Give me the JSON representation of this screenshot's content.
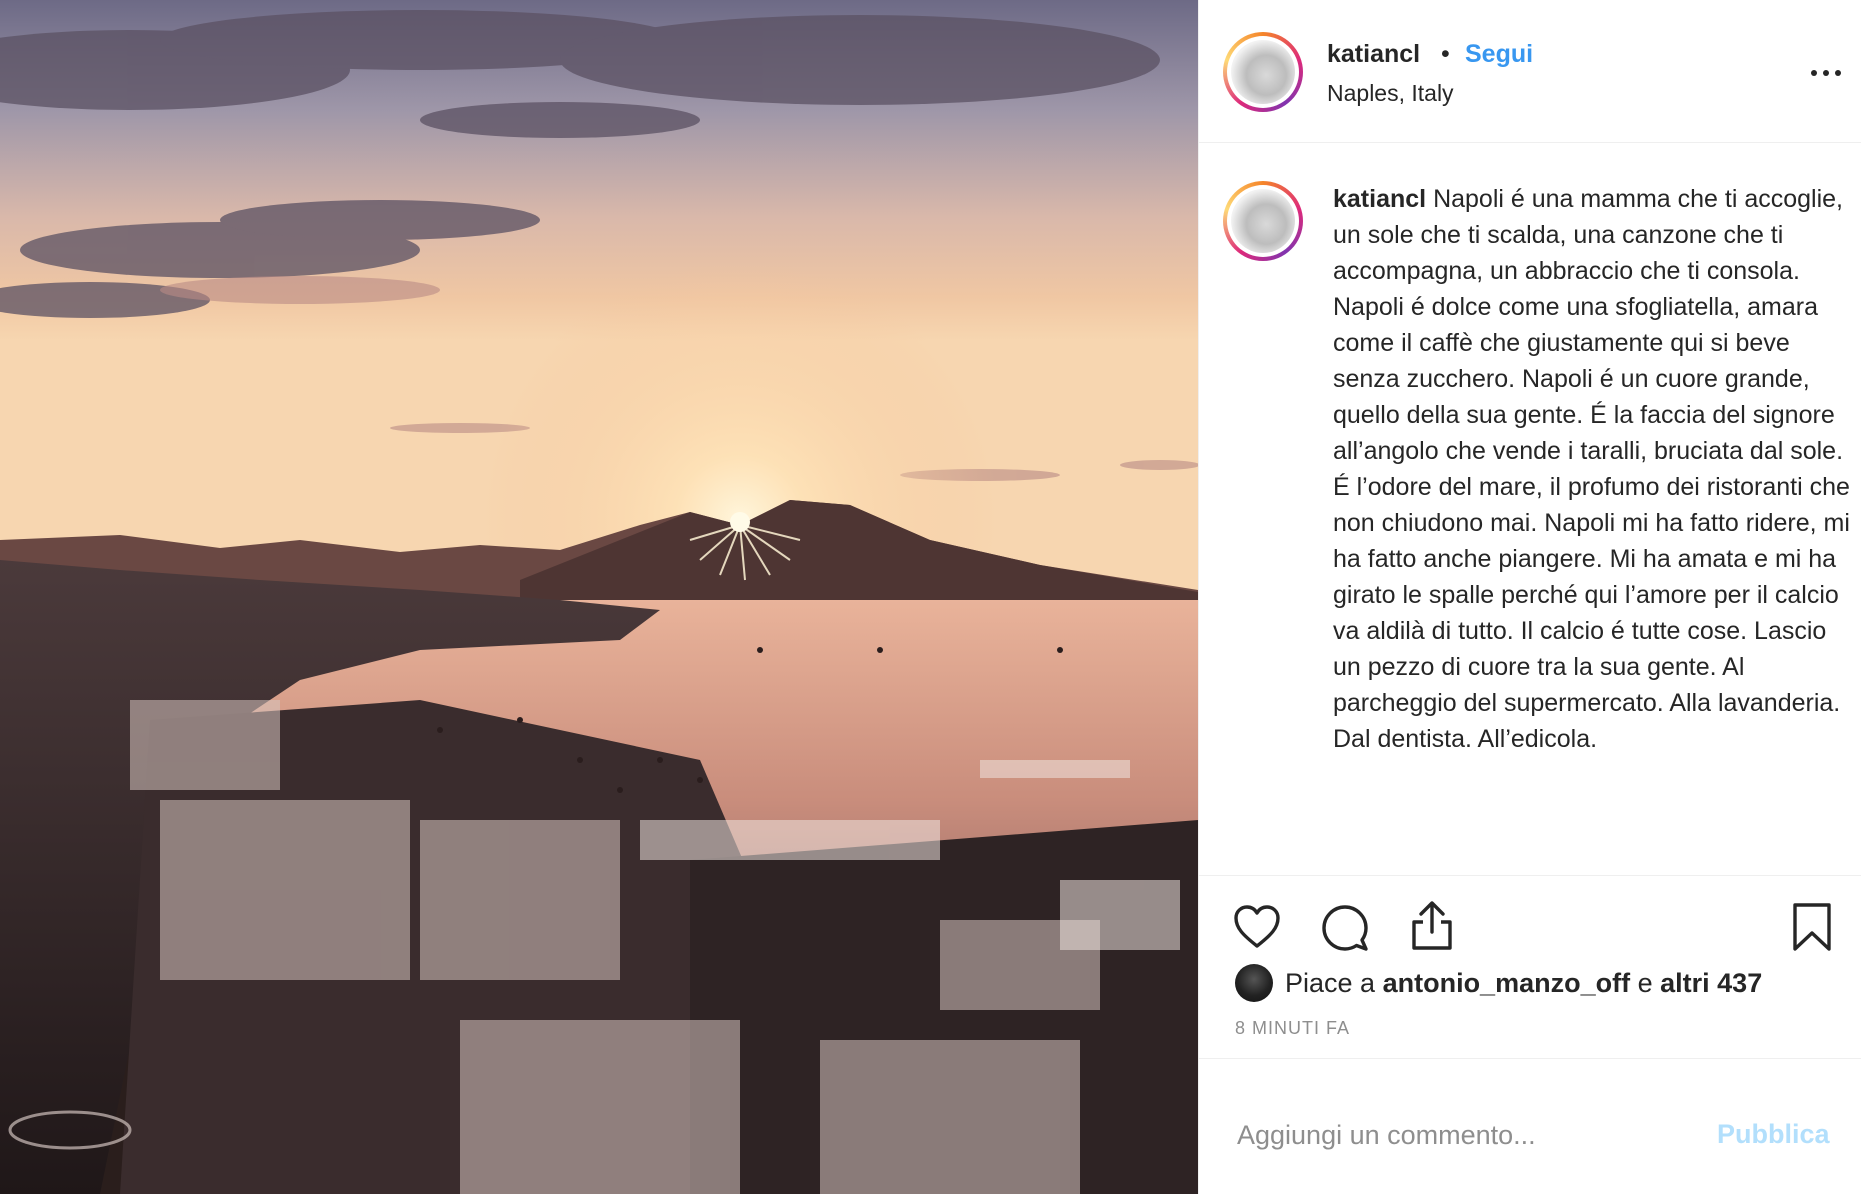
{
  "post": {
    "username": "katiancl",
    "separator": "•",
    "follow_label": "Segui",
    "location": "Naples, Italy",
    "more_icon": "more-horizontal-icon"
  },
  "caption": {
    "username": "katiancl",
    "text": "Napoli é una mamma che ti accoglie, un sole che ti scalda, una canzone che ti accompagna, un abbraccio che ti consola.\nNapoli é dolce come una sfogliatella, amara come il caffè che giustamente qui si beve senza zucchero. Napoli é un cuore grande, quello della sua gente. É la faccia del signore all’angolo che vende i taralli, bruciata dal sole. É l’odore del mare, il profumo dei ristoranti che non chiudono mai. Napoli mi ha fatto ridere, mi ha fatto anche piangere. Mi ha amata e mi ha girato le spalle perché qui l’amore per il calcio va aldilà di tutto. Il calcio é tutte cose. Lascio un pezzo di cuore tra la sua gente. Al parcheggio del supermercato. Alla lavanderia. Dal dentista. All’edicola."
  },
  "actions": {
    "like_icon": "heart-icon",
    "comment_icon": "comment-icon",
    "share_icon": "share-icon",
    "save_icon": "bookmark-icon"
  },
  "likes": {
    "prefix": "Piace a",
    "user": "antonio_manzo_off",
    "conjunction": "e",
    "others": "altri 437"
  },
  "timestamp": "8 MINUTI FA",
  "comment_box": {
    "placeholder": "Aggiungi un commento...",
    "publish_label": "Pubblica"
  },
  "colors": {
    "link_blue": "#3897f0",
    "publish_disabled": "#b2dffc",
    "text": "#262626",
    "muted": "#8e8e8e"
  }
}
